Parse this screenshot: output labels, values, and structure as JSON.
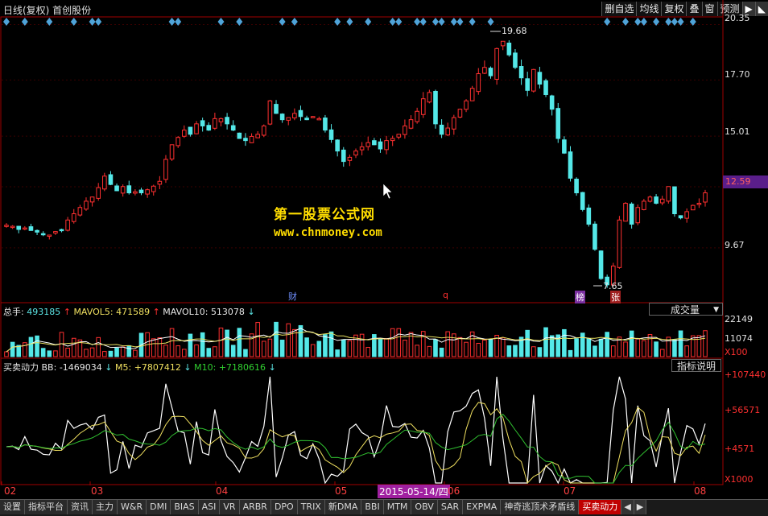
{
  "title": "日线(复权) 首创股份",
  "toolbar": {
    "items": [
      "删自选",
      "均线",
      "复权",
      "叠",
      "窗",
      "预测"
    ],
    "arrow_icon": "play-right-icon",
    "menu_icon": "menu-arrow-icon"
  },
  "price_axis": {
    "labels": [
      "20.35",
      "17.70",
      "15.01",
      "12.59",
      "9.67"
    ],
    "current_price": "12.59"
  },
  "price_marks": {
    "high": "19.68",
    "low": "7.65"
  },
  "event_tags": {
    "cai": "财",
    "q": "q",
    "bang": "榜",
    "zhang": "张"
  },
  "watermark": {
    "line1": "第一股票公式网",
    "line2": "www.chnmoney.com"
  },
  "volume_pane": {
    "total_label": "总手:",
    "total_value": "493185",
    "ma5_label": "MAVOL5:",
    "ma5_value": "471589",
    "ma10_label": "MAVOL10:",
    "ma10_value": "513078",
    "selector": "成交量",
    "axis": [
      "22149",
      "11074",
      "X100"
    ]
  },
  "indicator_pane": {
    "name": "买卖动力",
    "bb_label": "BB:",
    "bb_value": "-1469034",
    "m5_label": "M5:",
    "m5_value": "+7807412",
    "m10_label": "M10:",
    "m10_value": "+7180616",
    "help_button": "指标说明",
    "axis": [
      "+107440",
      "+56571",
      "+4571",
      "X1000"
    ]
  },
  "date_axis": {
    "months": [
      "02",
      "03",
      "04",
      "05",
      "06",
      "07",
      "08"
    ],
    "cursor_date": "2015-05-14/四"
  },
  "tabs": [
    "设置",
    "指标平台",
    "资讯",
    "主力",
    "W&R",
    "DMI",
    "BIAS",
    "ASI",
    "VR",
    "ARBR",
    "DPO",
    "TRIX",
    "新DMA",
    "BBI",
    "MTM",
    "OBV",
    "SAR",
    "EXPMA",
    "神奇逃顶术矛盾线",
    "买卖动力"
  ],
  "active_tab": "买卖动力",
  "colors": {
    "up": "#ff3030",
    "down": "#54e8e8",
    "border": "#a00000",
    "diamond": "#4fa3d8"
  },
  "chart_data": {
    "type": "candlestick",
    "close_series": [
      10.75,
      10.7,
      10.55,
      10.62,
      10.5,
      10.42,
      10.33,
      10.28,
      10.45,
      10.5,
      11.0,
      11.3,
      11.6,
      11.9,
      12.1,
      12.55,
      13.1,
      12.7,
      12.4,
      12.6,
      12.3,
      12.35,
      12.3,
      12.45,
      12.62,
      12.85,
      13.9,
      14.6,
      14.95,
      15.3,
      15.1,
      15.6,
      15.5,
      15.3,
      15.85,
      15.85,
      15.6,
      15.3,
      14.9,
      14.8,
      15.0,
      15.1,
      15.5,
      16.7,
      16.1,
      15.8,
      15.9,
      16.1,
      15.95,
      15.8,
      15.95,
      15.85,
      15.3,
      14.85,
      14.3,
      13.8,
      14.0,
      14.3,
      14.5,
      14.7,
      14.6,
      14.4,
      14.8,
      14.9,
      15.1,
      15.5,
      15.8,
      16.2,
      16.8,
      17.1,
      15.6,
      15.1,
      15.4,
      15.9,
      16.3,
      16.7,
      17.3,
      18.0,
      18.3,
      17.9,
      19.2,
      19.55,
      18.9,
      18.3,
      17.8,
      17.2,
      18.2,
      17.5,
      17.0,
      16.3,
      14.9,
      14.2,
      13.0,
      12.3,
      11.5,
      10.8,
      9.6,
      8.2,
      7.9,
      8.8,
      11.0,
      11.8,
      10.8,
      11.6,
      11.9,
      12.1,
      11.8,
      12.0,
      12.6,
      11.3,
      11.1,
      11.4,
      11.7,
      11.8,
      12.3
    ],
    "y_range": [
      7.2,
      20.6
    ],
    "volume": {
      "current": 493185,
      "mavol5": 471589,
      "mavol10": 513078,
      "axis_ticks": [
        22149,
        11074
      ],
      "unit": "X100"
    },
    "indicator": {
      "name": "买卖动力",
      "BB": -1469034,
      "M5": 7807412,
      "M10": 7180616,
      "axis_ticks": [
        107440,
        56571,
        4571
      ],
      "unit": "X1000"
    },
    "x_labels": [
      "02",
      "03",
      "04",
      "05",
      "06",
      "07",
      "08"
    ]
  }
}
